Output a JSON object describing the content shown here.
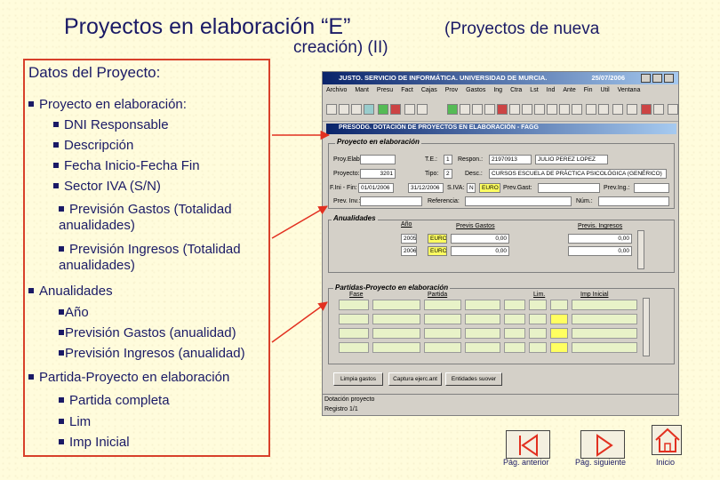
{
  "title": {
    "main": "Proyectos en elaboración “E”",
    "sub": "(Proyectos de nueva",
    "line2": "creación) (II)"
  },
  "left_panel": {
    "heading": "Datos del Proyecto:",
    "sections": [
      {
        "label": "Proyecto en elaboración:",
        "items": [
          "DNI Responsable",
          "Descripción",
          "Fecha Inicio-Fecha Fin",
          "Sector IVA (S/N)"
        ],
        "wrapped": [
          {
            "line1": "Previsión   Gastos   (Totalidad",
            "line2": "anualidades)"
          },
          {
            "line1": "Previsión   Ingresos   (Totalidad",
            "line2": "anualidades)"
          }
        ]
      },
      {
        "label": "Anualidades",
        "items": [
          "Año",
          "Previsión Gastos (anualidad)",
          "Previsión Ingresos (anualidad)"
        ]
      },
      {
        "label": "Partida-Proyecto en elaboración",
        "items": [
          "Partida completa",
          "Lim",
          "Imp Inicial"
        ]
      }
    ]
  },
  "app": {
    "title": "JUSTO. SERVICIO DE INFORMÁTICA. UNIVERSIDAD DE MURCIA.",
    "date": "25/07/2006",
    "menu": [
      "Archivo",
      "Mant",
      "Presu",
      "Fact",
      "Cajas",
      "Prov",
      "Gastos",
      "Ing",
      "Ctra",
      "Lst",
      "Ind",
      "Ante",
      "Fin",
      "Util",
      "Ventana"
    ],
    "form_title": "PRESODG. DOTACIÓN DE PROYECTOS EN ELABORACIÓN - FAGG",
    "proyecto": {
      "section": "Proyecto en elaboración",
      "labels": {
        "proy_elab": "Proy.Elab.:",
        "te": "T.E.:",
        "respon": "Respon.:",
        "proyecto": "Proyecto:",
        "tipo": "Tipo:",
        "desc": "Desc.:",
        "f_ini_fin": "F.Ini - Fin:",
        "s_iva": "S.IVA:",
        "prev_gast": "Prev.Gast:",
        "prev_ing": "Prev.Ing.:",
        "prev_inv": "Prev. Inv.:",
        "referencia": "Referencia:",
        "num": "Núm.:"
      },
      "values": {
        "te": "1",
        "respon_dni": "21970913",
        "respon_nombre": "JULIO PEREZ LOPEZ",
        "proyecto": "3201",
        "tipo": "2",
        "desc": "CURSOS ESCUELA DE PRÁCTICA PSICOLÓGICA (GENÉRICO)",
        "f_ini": "01/01/2006",
        "f_fin": "31/12/2006",
        "s_iva": "N",
        "moneda": "EURO"
      }
    },
    "anualidades": {
      "section": "Anualidades",
      "headers": {
        "ano": "Año",
        "gastos": "Previs Gastos",
        "ingresos": "Previs. Ingresos"
      },
      "rows": [
        {
          "ano": "2005",
          "moneda": "EURO",
          "gastos": "0,00",
          "ingresos": "0,00"
        },
        {
          "ano": "2006",
          "moneda": "EURO",
          "gastos": "0,00",
          "ingresos": "0,00"
        }
      ]
    },
    "partidas": {
      "section": "Partidas-Proyecto en elaboración",
      "headers": {
        "fase": "Fase",
        "partida": "Partida",
        "lim": "Lim.",
        "imp": "Imp Inicial"
      }
    },
    "buttons": [
      "Limpia gastos",
      "Captura ejerc.ant",
      "Entidades suover"
    ],
    "status": {
      "line1": "Dotación proyecto",
      "line2": "Registro 1/1"
    }
  },
  "nav": {
    "prev": "Pág. anterior",
    "next": "Pág. siguiente",
    "home": "Inicio"
  },
  "colors": {
    "title": "#1a1a66",
    "panel_border": "#d8402a",
    "arrow": "#e23020",
    "background": "#fffcdc"
  }
}
